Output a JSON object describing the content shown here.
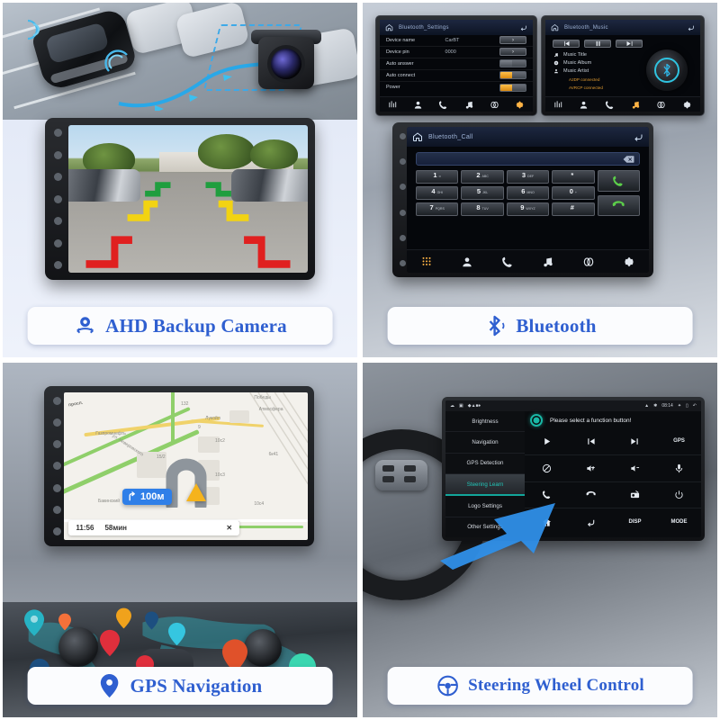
{
  "panels": {
    "backup_camera": {
      "caption": "AHD Backup Camera",
      "caption_icon": "backup-camera-icon",
      "guideline_colors": [
        "#1f9e3e",
        "#f2d312",
        "#e02020"
      ]
    },
    "bluetooth": {
      "caption": "Bluetooth",
      "caption_icon": "bluetooth-icon",
      "settings_screen": {
        "title": "Bluetooth_Settings",
        "rows": [
          {
            "label": "Device name",
            "value": "CarBT",
            "control": "arrow"
          },
          {
            "label": "Device pin",
            "value": "0000",
            "control": "arrow"
          },
          {
            "label": "Auto answer",
            "value": "",
            "control": "toggle_off"
          },
          {
            "label": "Auto connect",
            "value": "",
            "control": "toggle_on"
          },
          {
            "label": "Power",
            "value": "",
            "control": "toggle_on"
          }
        ],
        "nav": [
          "equalizer-icon",
          "contacts-icon",
          "call-history-icon",
          "music-icon",
          "link-icon",
          "settings-icon"
        ],
        "nav_active": 5
      },
      "music_screen": {
        "title": "Bluetooth_Music",
        "transport": [
          "prev-track-icon",
          "pause-icon",
          "next-track-icon"
        ],
        "meta": [
          {
            "icon": "note-icon",
            "label": "Music Title"
          },
          {
            "icon": "album-icon",
            "label": "Music Album"
          },
          {
            "icon": "artist-icon",
            "label": "Music Artist"
          }
        ],
        "status": [
          "A2DP connected",
          "AVRCP connected"
        ],
        "nav": [
          "equalizer-icon",
          "contacts-icon",
          "call-history-icon",
          "music-icon",
          "link-icon",
          "settings-icon"
        ],
        "nav_active": 3
      },
      "call_screen": {
        "title": "Bluetooth_Call",
        "input_value": "",
        "delete_icon": "backspace-icon",
        "keys": [
          {
            "num": "1",
            "sub": "∞"
          },
          {
            "num": "2",
            "sub": "ABC"
          },
          {
            "num": "3",
            "sub": "DEF"
          },
          {
            "num": "*",
            "sub": ""
          },
          {
            "num": "4",
            "sub": "GHI"
          },
          {
            "num": "5",
            "sub": "JKL"
          },
          {
            "num": "6",
            "sub": "MNO"
          },
          {
            "num": "0",
            "sub": "+"
          },
          {
            "num": "7",
            "sub": "PQRS"
          },
          {
            "num": "8",
            "sub": "TUV"
          },
          {
            "num": "9",
            "sub": "WXYZ"
          },
          {
            "num": "#",
            "sub": ""
          }
        ],
        "call_buttons": [
          "dial-call-icon",
          "end-call-icon"
        ],
        "nav": [
          "dialpad-icon",
          "contacts-icon",
          "call-history-icon",
          "music-icon",
          "link-icon",
          "settings-icon"
        ],
        "nav_active": 0
      }
    },
    "gps": {
      "caption": "GPS Navigation",
      "caption_icon": "map-pin-icon",
      "map": {
        "turn_distance": "100м",
        "turn_icon": "turn-right-icon",
        "arrival_time": "11:56",
        "duration": "58мин",
        "close_icon": "close-icon",
        "labels": [
          "просп.",
          "Лукойл",
          "Газпромнефть",
          "ул. Неверовского",
          "Бакинский",
          "Атмосфера",
          "Победы",
          "Crosswall",
          "10с2",
          "10с3",
          "10с4",
          "15/2",
          "132",
          "10",
          "9",
          "6к41"
        ]
      },
      "pin_colors": [
        "#27b3c4",
        "#f4713a",
        "#f0a21c",
        "#1d4f80",
        "#e02f3c",
        "#35c6e0",
        "#e0512a",
        "#1d4f80",
        "#e02f3c",
        "#3ad6b0",
        "#8a4fd0",
        "#b9d94a",
        "#e06a2a"
      ]
    },
    "steering": {
      "caption": "Steering Wheel Control",
      "caption_icon": "steering-wheel-icon",
      "screen": {
        "status_time": "08:14",
        "sidebar": [
          "Brightness",
          "Navigation",
          "GPS Detection",
          "Steering Learn",
          "Logo Settings",
          "Other Settings"
        ],
        "sidebar_selected": 3,
        "prompt": "Please select a function button!",
        "functions": [
          {
            "label": "",
            "icon": "play-icon"
          },
          {
            "label": "",
            "icon": "prev-track-icon"
          },
          {
            "label": "",
            "icon": "next-track-icon"
          },
          {
            "label": "GPS",
            "icon": ""
          },
          {
            "label": "",
            "icon": "mute-icon"
          },
          {
            "label": "",
            "icon": "volume-up-icon"
          },
          {
            "label": "",
            "icon": "volume-down-icon"
          },
          {
            "label": "",
            "icon": "mic-icon"
          },
          {
            "label": "",
            "icon": "answer-call-icon"
          },
          {
            "label": "",
            "icon": "hangup-call-icon"
          },
          {
            "label": "",
            "icon": "radio-icon"
          },
          {
            "label": "",
            "icon": "power-icon"
          },
          {
            "label": "",
            "icon": "home-icon"
          },
          {
            "label": "",
            "icon": "back-icon"
          },
          {
            "label": "DISP",
            "icon": ""
          },
          {
            "label": "MODE",
            "icon": ""
          }
        ]
      }
    }
  },
  "theme": {
    "accent_blue": "#2f5fd0",
    "panel_bg": "#eef2fb",
    "screen_bg": "#05070b",
    "toggle_on": "#ffc04a",
    "selected_teal": "#22c6b8"
  }
}
